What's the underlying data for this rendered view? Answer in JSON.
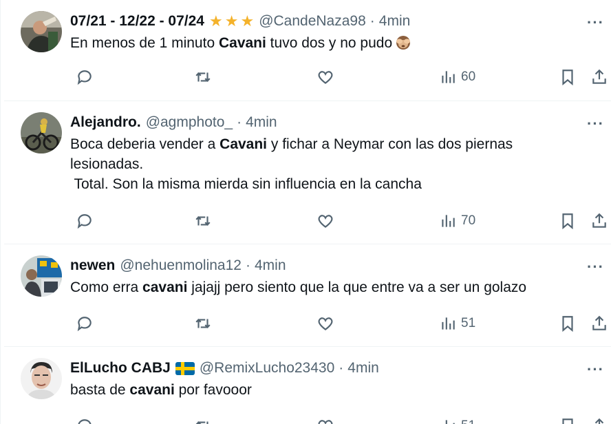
{
  "tweets": [
    {
      "display_name": "07/21 - 12/22 - 07/24",
      "badge": "three-stars",
      "handle": "@CandeNaza98",
      "time": "4min",
      "text_parts": [
        "En menos de 1 minuto ",
        "Cavani",
        " tuvo dos y no pudo"
      ],
      "emoji": "see-no-evil-monkey",
      "views": "60"
    },
    {
      "display_name": "Alejandro.",
      "handle": "@agmphoto_",
      "time": "4min",
      "text_parts": [
        "Boca deberia vender a ",
        "Cavani",
        " y fichar a Neymar con las dos piernas lesionadas."
      ],
      "text_line2": " Total. Son la misma mierda sin influencia en la cancha",
      "views": "70"
    },
    {
      "display_name": "newen",
      "handle": "@nehuenmolina12",
      "time": "4min",
      "text_parts": [
        "Como erra ",
        "cavani",
        " jajajj pero siento que la que entre va a ser un golazo"
      ],
      "views": "51"
    },
    {
      "display_name": "ElLucho CABJ",
      "badge": "sweden-flag",
      "handle": "@RemixLucho23430",
      "time": "4min",
      "text_parts": [
        "basta de ",
        "cavani",
        " por favooor"
      ],
      "views": "51"
    }
  ],
  "ui": {
    "dot": "·",
    "more": "···",
    "star": "★"
  },
  "colors": {
    "text": "#0f1419",
    "secondary": "#536471",
    "divider": "#eff3f4",
    "star": "#f4b22b"
  },
  "icons": {
    "reply": "reply-icon",
    "retweet": "retweet-icon",
    "like": "heart-icon",
    "views": "views-chart-icon",
    "bookmark": "bookmark-icon",
    "share": "share-icon",
    "more": "more-dots-icon"
  }
}
